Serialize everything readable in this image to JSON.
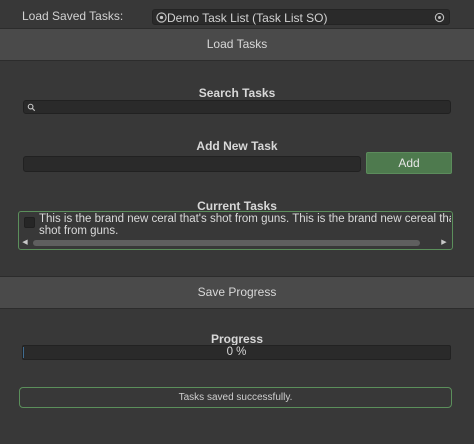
{
  "saved_tasks": {
    "label": "Load Saved Tasks:",
    "object_value": "Demo Task List (Task List SO)"
  },
  "load_section": {
    "button_label": "Load Tasks"
  },
  "search": {
    "heading": "Search Tasks",
    "value": ""
  },
  "add_task": {
    "heading": "Add New Task",
    "input_value": "",
    "button_label": "Add"
  },
  "current_tasks": {
    "heading": "Current Tasks",
    "items": [
      {
        "checked": false,
        "text_line1": "This is the brand new ceral that's shot from guns.  This is the brand new cereal that's",
        "text_line2": "shot from guns."
      }
    ]
  },
  "save_section": {
    "button_label": "Save Progress"
  },
  "progress": {
    "heading": "Progress",
    "value_text": "0 %",
    "fraction": 0
  },
  "status": {
    "message": "Tasks saved successfully."
  },
  "colors": {
    "background": "#383838",
    "section_bar": "#4a4a4a",
    "accent_green": "#4e7a4e",
    "outline_green": "#5b8f5b",
    "field": "#2a2a2a"
  },
  "icons": {
    "object": "scriptable-object-icon",
    "picker": "object-picker-icon",
    "search": "search-icon",
    "scroll_left": "arrow-left-icon",
    "scroll_right": "arrow-right-icon"
  }
}
